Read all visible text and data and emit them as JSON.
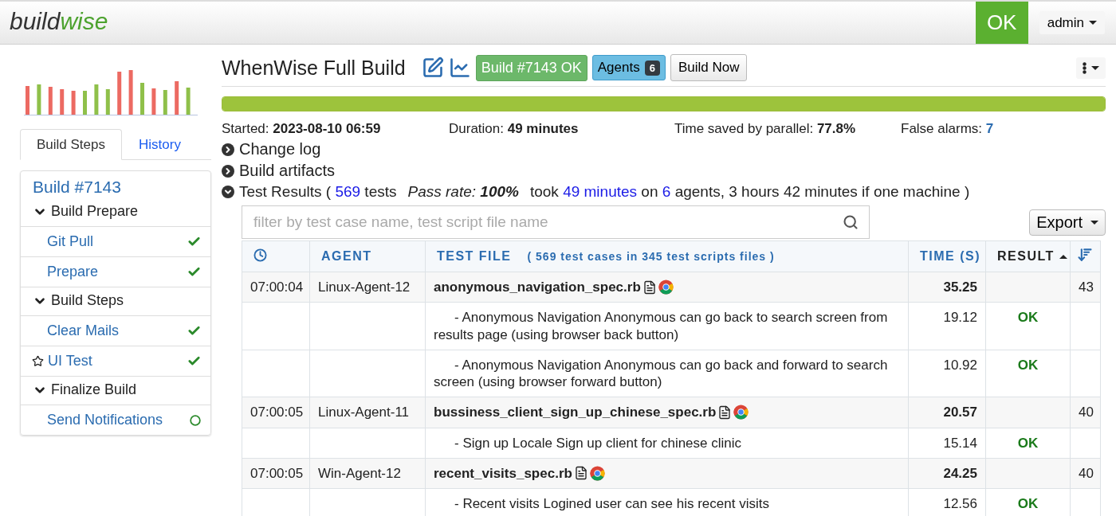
{
  "header": {
    "logo_first": "build",
    "logo_second": "wise",
    "status": "OK",
    "user": "admin"
  },
  "sidebar": {
    "tabs": [
      {
        "label": "Build Steps",
        "selected": true
      },
      {
        "label": "History",
        "selected": false
      }
    ],
    "items": [
      {
        "kind": "build",
        "label": "Build #7143"
      },
      {
        "kind": "group",
        "label": "Build Prepare"
      },
      {
        "kind": "step",
        "label": "Git Pull",
        "starred": false,
        "passed": true
      },
      {
        "kind": "step",
        "label": "Prepare",
        "starred": false,
        "passed": true
      },
      {
        "kind": "group",
        "label": "Build Steps"
      },
      {
        "kind": "step",
        "label": "Clear Mails",
        "starred": false,
        "passed": true
      },
      {
        "kind": "step",
        "label": "UI Test",
        "starred": true,
        "passed": true
      },
      {
        "kind": "group",
        "label": "Finalize Build"
      },
      {
        "kind": "step",
        "label": "Send Notifications",
        "starred": false,
        "passed": false
      }
    ]
  },
  "project": {
    "title": "WhenWise Full Build",
    "build_badge": "Build #7143 OK",
    "agents_label": "Agents",
    "agents_count": "6",
    "build_now": "Build Now",
    "progress": {
      "level": 1
    }
  },
  "stats": [
    {
      "label": "Started:",
      "value": "2023-08-10 06:59",
      "kind": "plain"
    },
    {
      "label": "Duration:",
      "value": "49 minutes",
      "kind": "plain"
    },
    {
      "label": "Time saved by parallel:",
      "value": "77.8%",
      "kind": "plain"
    },
    {
      "label": "False alarms:",
      "value": "7",
      "kind": "link"
    }
  ],
  "sections": [
    {
      "label": "Change log",
      "expanded": false
    },
    {
      "label": "Build artifacts",
      "expanded": false
    }
  ],
  "test_results": {
    "expanded": true,
    "parts": [
      {
        "kind": "text",
        "text": "Test Results ( "
      },
      {
        "kind": "link",
        "text": "569"
      },
      {
        "kind": "text",
        "text": " tests"
      },
      {
        "kind": "em",
        "text": "Pass rate: **100%**"
      },
      {
        "kind": "text",
        "text": "took "
      },
      {
        "kind": "link",
        "text": "49 minutes"
      },
      {
        "kind": "text",
        "text": " on "
      },
      {
        "kind": "link",
        "text": "6"
      },
      {
        "kind": "text",
        "text": " agents, 3 hours 42 minutes if one machine )"
      }
    ]
  },
  "filter": {
    "placeholder": "filter by test case name, test script file name"
  },
  "export": "Export",
  "table": {
    "columns": [
      {
        "label": "AGENT",
        "sorted": false
      },
      {
        "label": "TEST FILE",
        "note": "( **569** test cases in **345** test scripts files )",
        "sorted": false
      },
      {
        "label": "TIME (S)",
        "sorted": false
      },
      {
        "label": "RESULT",
        "sorted": true
      }
    ],
    "rows": [
      {
        "kind": "file",
        "time": "07:00:04",
        "agent": "Linux-Agent-12",
        "file": "anonymous_navigation_spec.rb",
        "duration": "35.25",
        "count": "43"
      },
      {
        "kind": "case",
        "name": "- Anonymous Navigation Anonymous can go back to search screen from results page (using browser back button)",
        "duration": "19.12",
        "result": "OK"
      },
      {
        "kind": "case",
        "name": "- Anonymous Navigation Anonymous can go back and forward to search screen (using browser forward button)",
        "duration": "10.92",
        "result": "OK"
      },
      {
        "kind": "file",
        "time": "07:00:05",
        "agent": "Linux-Agent-11",
        "file": "bussiness_client_sign_up_chinese_spec.rb",
        "duration": "20.57",
        "count": "40"
      },
      {
        "kind": "case",
        "name": "- Sign up Locale Sign up client for chinese clinic",
        "duration": "15.14",
        "result": "OK"
      },
      {
        "kind": "file",
        "time": "07:00:05",
        "agent": "Win-Agent-12",
        "file": "recent_visits_spec.rb",
        "duration": "24.25",
        "count": "40"
      },
      {
        "kind": "case",
        "name": "- Recent visits Logined user can see his recent visits",
        "duration": "12.56",
        "result": "OK"
      }
    ]
  }
}
